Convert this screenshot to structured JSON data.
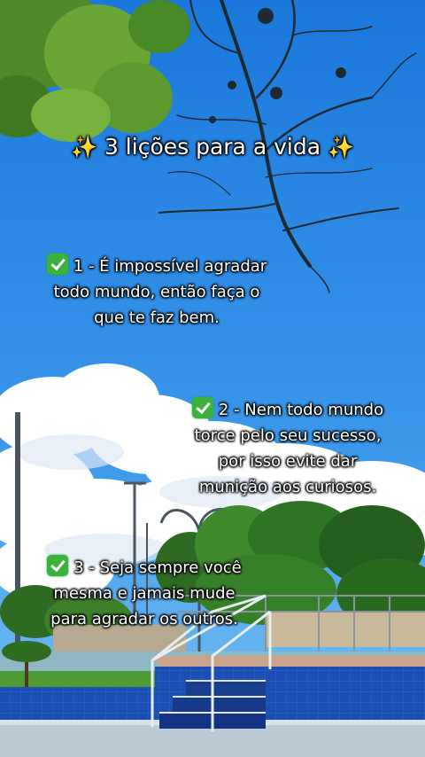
{
  "title": {
    "sparkle_left": "✨",
    "text": "3 lições para a vida",
    "sparkle_right": "✨"
  },
  "lessons": [
    {
      "icon": "check-mark-button-emoji",
      "lines": [
        "1 - É impossível agradar",
        "todo mundo, então faça o",
        "que te faz bem."
      ]
    },
    {
      "icon": "check-mark-button-emoji",
      "lines": [
        "2 - Nem todo mundo",
        "torce pelo seu sucesso,",
        "por isso evite dar",
        "munição aos curiosos."
      ]
    },
    {
      "icon": "check-mark-button-emoji",
      "lines": [
        "3 - Seja sempre você",
        "mesma e jamais mude",
        "para agradar os outros."
      ]
    }
  ],
  "colors": {
    "sky_top": "#1f7fe0",
    "sky_bottom": "#56aef0",
    "cloud": "#ffffff",
    "pool_tile": "#1e4fb5",
    "grass": "#4f9a35",
    "check": "#3db13d"
  }
}
